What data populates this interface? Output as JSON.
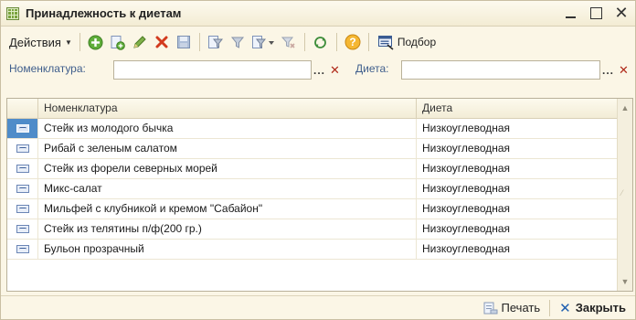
{
  "window": {
    "title": "Принадлежность к диетам",
    "min_label": "",
    "max_label": "",
    "close_label": "✕"
  },
  "toolbar": {
    "actions_label": "Действия",
    "podbor_label": "Подбор",
    "icons": [
      "add-icon",
      "copy-icon",
      "edit-icon",
      "delete-icon",
      "save-icon",
      "filter-icon",
      "filter-by-value-icon",
      "filter-list-icon",
      "clear-filter-icon",
      "refresh-icon",
      "help-icon",
      "selection-icon"
    ]
  },
  "filters": {
    "nomenclature_label": "Номенклатура:",
    "nomenclature_value": "",
    "diet_label": "Диета:",
    "diet_value": "",
    "dots": "...",
    "clear": "✕"
  },
  "table": {
    "columns": [
      "Номенклатура",
      "Диета"
    ],
    "rows": [
      {
        "name": "Стейк из молодого бычка",
        "diet": "Низкоуглеводная",
        "selected": true
      },
      {
        "name": "Рибай с зеленым салатом",
        "diet": "Низкоуглеводная",
        "selected": false
      },
      {
        "name": "Стейк из форели северных морей",
        "diet": "Низкоуглеводная",
        "selected": false
      },
      {
        "name": "Микс-салат",
        "diet": "Низкоуглеводная",
        "selected": false
      },
      {
        "name": "Мильфей с клубникой и кремом \"Сабайон\"",
        "diet": "Низкоуглеводная",
        "selected": false
      },
      {
        "name": "Стейк из телятины п/ф(200 гр.)",
        "diet": "Низкоуглеводная",
        "selected": false
      },
      {
        "name": "Бульон прозрачный",
        "diet": "Низкоуглеводная",
        "selected": false
      }
    ]
  },
  "footer": {
    "print_label": "Печать",
    "close_label": "Закрыть"
  },
  "colors": {
    "accent": "#4f8cc9",
    "background": "#fbf6e6",
    "label_blue": "#3f5e8c",
    "delete_red": "#d23a1e"
  }
}
